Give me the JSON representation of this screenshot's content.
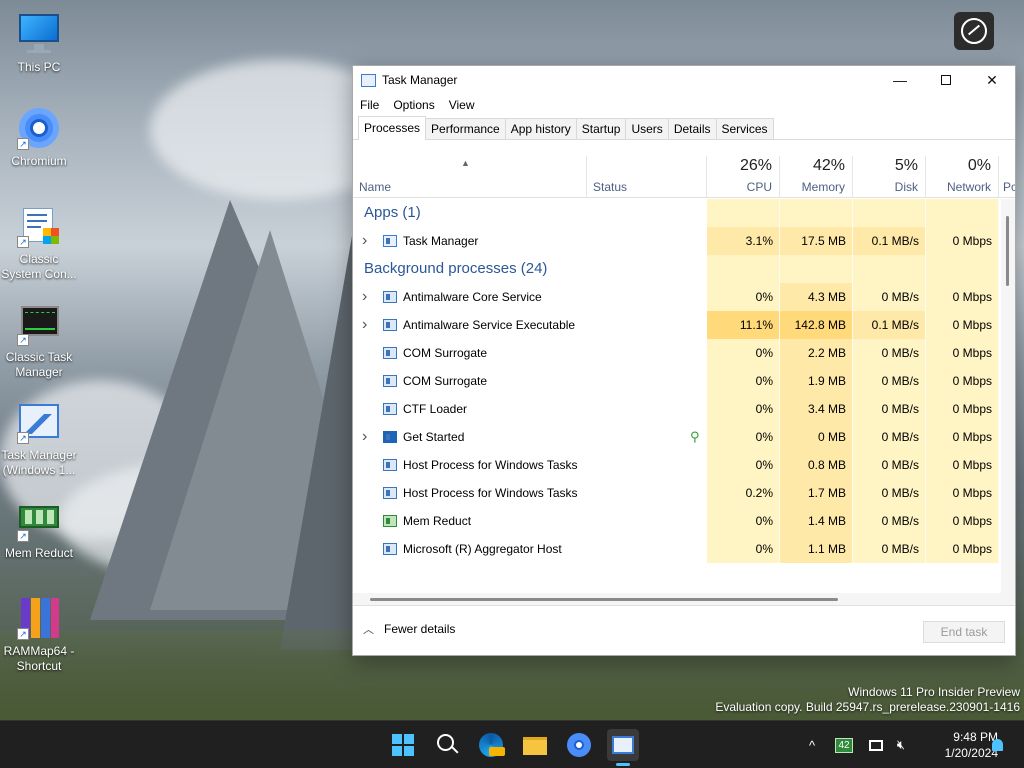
{
  "desktop": {
    "icons": [
      {
        "label": "This PC",
        "icon": "monitor-icon"
      },
      {
        "label": "Chromium",
        "icon": "chromium-icon"
      },
      {
        "label": "Classic System Con...",
        "icon": "control-panel-icon"
      },
      {
        "label": "Classic Task Manager",
        "icon": "classic-task-manager-icon"
      },
      {
        "label": "Task Manager (Windows 1...",
        "icon": "task-manager-icon"
      },
      {
        "label": "Mem Reduct",
        "icon": "mem-reduct-icon"
      },
      {
        "label": "RAMMap64 - Shortcut",
        "icon": "rammap-icon"
      }
    ],
    "watermark_line1": "Windows 11 Pro Insider Preview",
    "watermark_line2": "Evaluation copy. Build 25947.rs_prerelease.230901-1416"
  },
  "window": {
    "title": "Task Manager",
    "menu": [
      "File",
      "Options",
      "View"
    ],
    "tabs": [
      "Processes",
      "Performance",
      "App history",
      "Startup",
      "Users",
      "Details",
      "Services"
    ],
    "active_tab": "Processes",
    "columns": {
      "name": "Name",
      "status": "Status",
      "cpu": {
        "label": "CPU",
        "pct": "26%"
      },
      "memory": {
        "label": "Memory",
        "pct": "42%"
      },
      "disk": {
        "label": "Disk",
        "pct": "5%"
      },
      "network": {
        "label": "Network",
        "pct": "0%"
      },
      "power": "Po"
    },
    "groups": {
      "apps": "Apps (1)",
      "background": "Background processes (24)"
    },
    "apps": [
      {
        "name": "Task Manager",
        "cpu": "3.1%",
        "memory": "17.5 MB",
        "disk": "0.1 MB/s",
        "network": "0 Mbps",
        "expandable": true,
        "icon": "tm"
      }
    ],
    "background": [
      {
        "name": "Antimalware Core Service",
        "cpu": "0%",
        "memory": "4.3 MB",
        "disk": "0 MB/s",
        "network": "0 Mbps",
        "expandable": true,
        "icon": "app"
      },
      {
        "name": "Antimalware Service Executable",
        "cpu": "11.1%",
        "memory": "142.8 MB",
        "disk": "0.1 MB/s",
        "network": "0 Mbps",
        "expandable": true,
        "icon": "app"
      },
      {
        "name": "COM Surrogate",
        "cpu": "0%",
        "memory": "2.2 MB",
        "disk": "0 MB/s",
        "network": "0 Mbps",
        "expandable": false,
        "icon": "app"
      },
      {
        "name": "COM Surrogate",
        "cpu": "0%",
        "memory": "1.9 MB",
        "disk": "0 MB/s",
        "network": "0 Mbps",
        "expandable": false,
        "icon": "app"
      },
      {
        "name": "CTF Loader",
        "cpu": "0%",
        "memory": "3.4 MB",
        "disk": "0 MB/s",
        "network": "0 Mbps",
        "expandable": false,
        "icon": "app"
      },
      {
        "name": "Get Started",
        "cpu": "0%",
        "memory": "0 MB",
        "disk": "0 MB/s",
        "network": "0 Mbps",
        "expandable": true,
        "icon": "blue",
        "status_icon": "leaf-icon"
      },
      {
        "name": "Host Process for Windows Tasks",
        "cpu": "0%",
        "memory": "0.8 MB",
        "disk": "0 MB/s",
        "network": "0 Mbps",
        "expandable": false,
        "icon": "app"
      },
      {
        "name": "Host Process for Windows Tasks",
        "cpu": "0.2%",
        "memory": "1.7 MB",
        "disk": "0 MB/s",
        "network": "0 Mbps",
        "expandable": false,
        "icon": "app"
      },
      {
        "name": "Mem Reduct",
        "cpu": "0%",
        "memory": "1.4 MB",
        "disk": "0 MB/s",
        "network": "0 Mbps",
        "expandable": false,
        "icon": "green"
      },
      {
        "name": "Microsoft (R) Aggregator Host",
        "cpu": "0%",
        "memory": "1.1 MB",
        "disk": "0 MB/s",
        "network": "0 Mbps",
        "expandable": false,
        "icon": "app"
      }
    ],
    "footer": {
      "fewer_details": "Fewer details",
      "end_task": "End task"
    }
  },
  "taskbar": {
    "apps": [
      "start-icon",
      "search-icon",
      "edge-pre-icon",
      "file-explorer-icon",
      "chromium-icon",
      "task-manager-icon"
    ],
    "tray_badge": "42",
    "time": "9:48 PM",
    "date": "1/20/2024"
  },
  "colors": {
    "heat_light": "#fff4c4",
    "heat_mid": "#ffe9a8",
    "heat_strong": "#ffd97a",
    "group_text": "#2b5797",
    "taskbar": "#202020",
    "accent": "#4cc2ff"
  }
}
